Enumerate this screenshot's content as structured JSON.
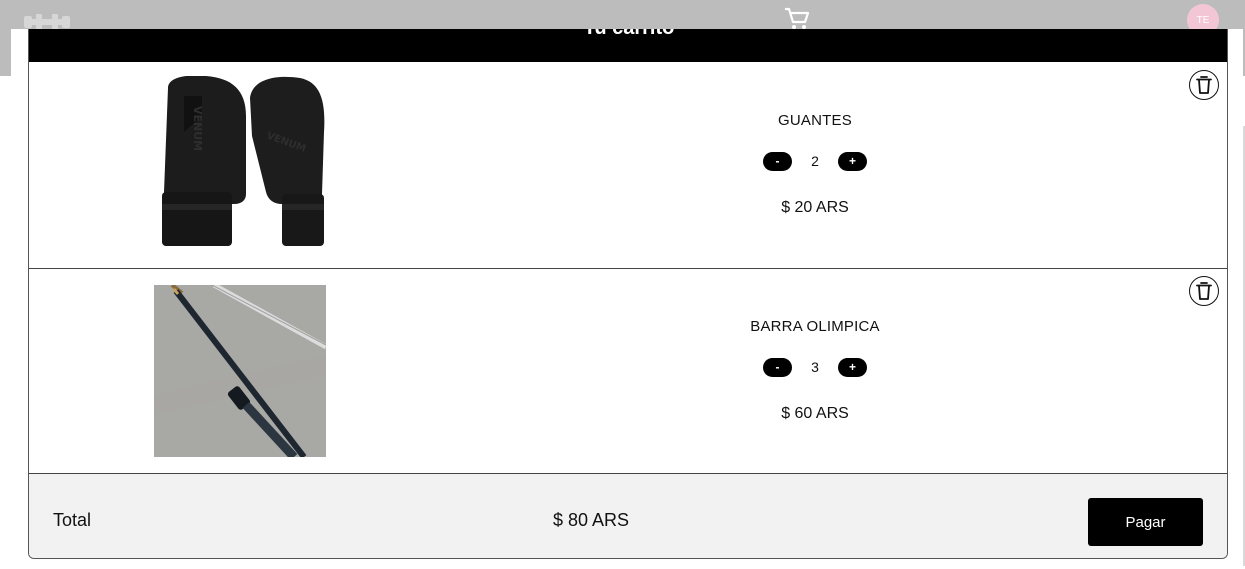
{
  "background": {
    "avatar_initials": "TE",
    "cart_icon": "cart-icon",
    "logo_icon": "dumbbell-icon"
  },
  "cart": {
    "title": "Tu carrito",
    "items": [
      {
        "name": "GUANTES",
        "decrement_label": "-",
        "quantity": "2",
        "increment_label": "+",
        "price": "$ 20 ARS",
        "image": "boxing-gloves-image",
        "delete_icon": "trash-icon"
      },
      {
        "name": "BARRA OLIMPICA",
        "decrement_label": "-",
        "quantity": "3",
        "increment_label": "+",
        "price": "$ 60 ARS",
        "image": "barbell-image",
        "delete_icon": "trash-icon"
      }
    ],
    "total_label": "Total",
    "total_value": "$ 80 ARS",
    "pay_label": "Pagar"
  },
  "colors": {
    "header_bg": "#000000",
    "footer_bg": "#f2f2f2",
    "button_bg": "#000000",
    "avatar_bg": "#f3c6d6"
  }
}
